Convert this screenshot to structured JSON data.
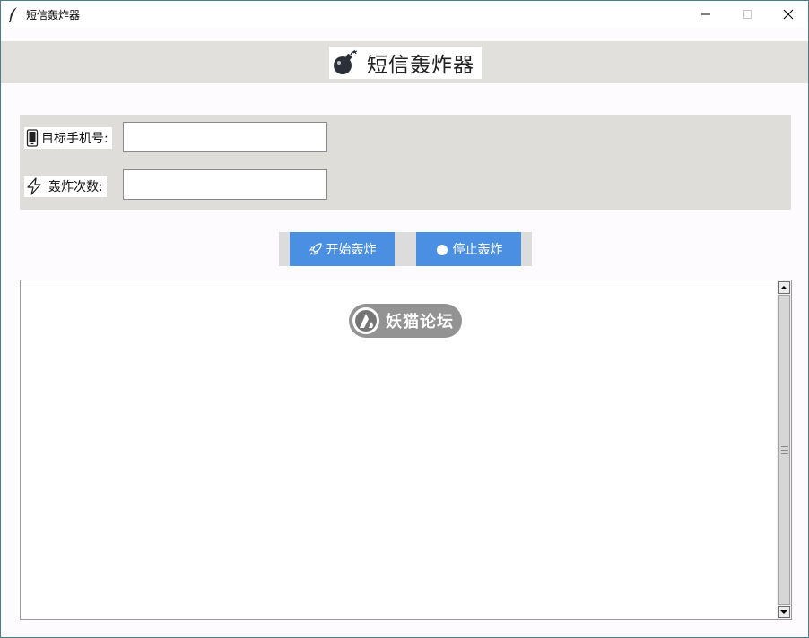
{
  "window": {
    "title": "短信轰炸器",
    "controls": [
      "minimize",
      "maximize",
      "close"
    ]
  },
  "header": {
    "icon": "bomb-icon",
    "title": "短信轰炸器"
  },
  "form": {
    "phone_label": "目标手机号:",
    "phone_icon": "phone-icon",
    "phone_value": "",
    "count_label": "轰炸次数:",
    "count_icon": "lightning-icon",
    "count_value": ""
  },
  "buttons": {
    "start_label": "开始轰炸",
    "start_icon": "rocket-icon",
    "stop_label": "停止轰炸",
    "stop_icon": "stop-circle-icon"
  },
  "log": {
    "content": ""
  },
  "watermark": {
    "text": "妖猫论坛"
  },
  "colors": {
    "accent": "#4a8fe2",
    "panel": "#dfddd9",
    "header_band": "#e2e0dd"
  }
}
